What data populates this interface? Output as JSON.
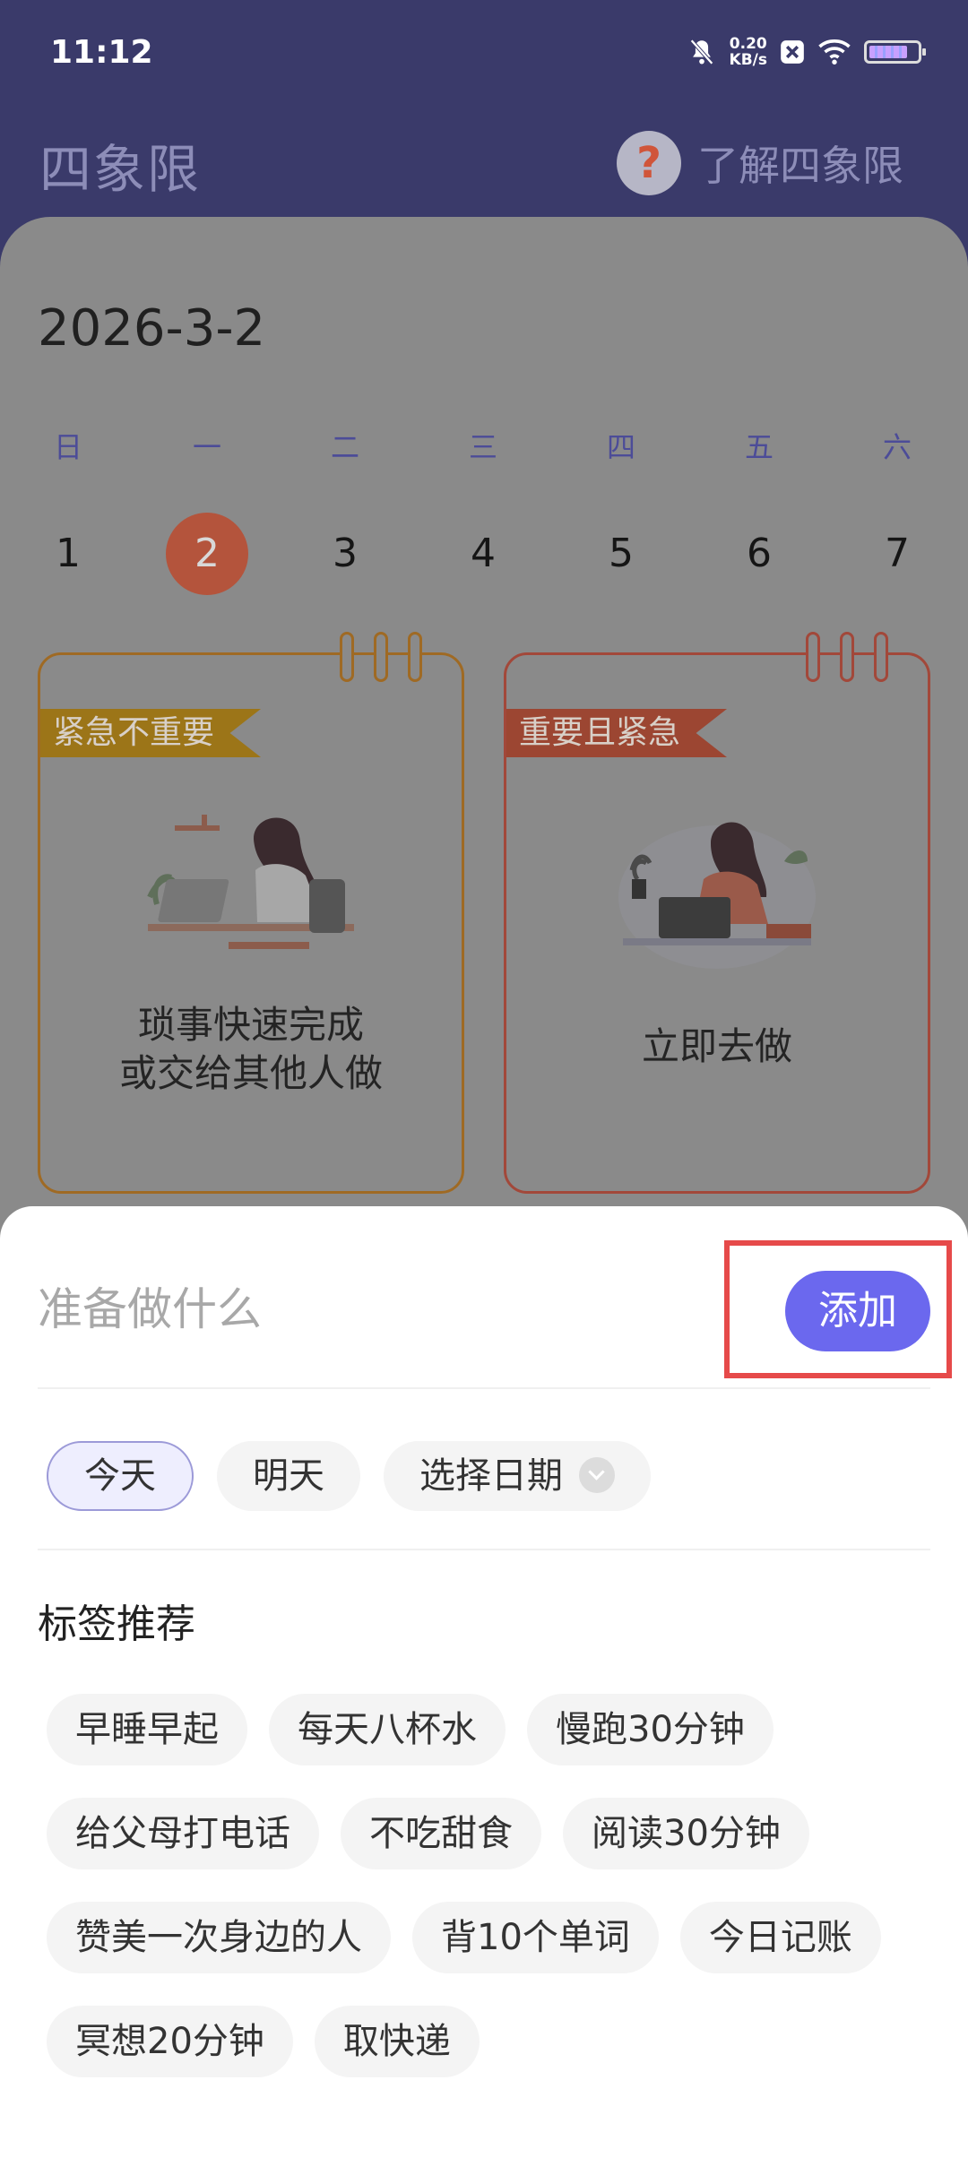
{
  "status_bar": {
    "time": "11:12",
    "net_speed_value": "0.20",
    "net_speed_unit": "KB/s"
  },
  "header": {
    "title": "四象限",
    "help_label": "了解四象限"
  },
  "calendar": {
    "date": "2026-3-2",
    "weekdays": [
      "日",
      "一",
      "二",
      "三",
      "四",
      "五",
      "六"
    ],
    "days": [
      "1",
      "2",
      "3",
      "4",
      "5",
      "6",
      "7"
    ],
    "selected_day": "2"
  },
  "quadrants": [
    {
      "tag": "紧急不重要",
      "line1": "琐事快速完成",
      "line2": "或交给其他人做"
    },
    {
      "tag": "重要且紧急",
      "line1": "立即去做"
    }
  ],
  "sheet": {
    "input_placeholder": "准备做什么",
    "add_label": "添加",
    "date_options": [
      "今天",
      "明天",
      "选择日期"
    ],
    "selected_date_option": "今天",
    "tags_title": "标签推荐",
    "tags": [
      "早睡早起",
      "每天八杯水",
      "慢跑30分钟",
      "给父母打电话",
      "不吃甜食",
      "阅读30分钟",
      "赞美一次身边的人",
      "背10个单词",
      "今日记账",
      "冥想20分钟",
      "取快递"
    ]
  },
  "colors": {
    "accent": "#6b68ee",
    "highlight": "#e64a4a",
    "header_bg": "#3a3a6a",
    "selected_day": "#b4543c"
  }
}
